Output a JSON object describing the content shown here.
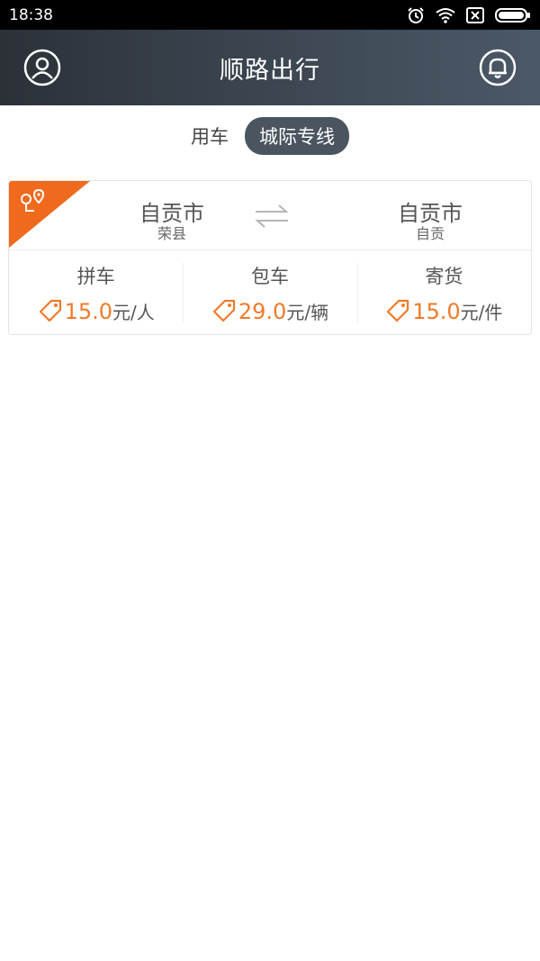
{
  "status": {
    "time": "18:38"
  },
  "header": {
    "title": "顺路出行"
  },
  "tabs": [
    {
      "label": "用车",
      "active": false
    },
    {
      "label": "城际专线",
      "active": true
    }
  ],
  "route": {
    "from": {
      "city": "自贡市",
      "district": "荣县"
    },
    "to": {
      "city": "自贡市",
      "district": "自贡"
    }
  },
  "services": [
    {
      "label": "拼车",
      "price": "15.0",
      "unit": "元/人"
    },
    {
      "label": "包车",
      "price": "29.0",
      "unit": "元/辆"
    },
    {
      "label": "寄货",
      "price": "15.0",
      "unit": "元/件"
    }
  ],
  "colors": {
    "accent": "#f07a2a",
    "header_dark": "#2c3138",
    "header_light": "#4b5866",
    "tab_active_bg": "#4a5560"
  },
  "icons": {
    "profile": "user-circle-icon",
    "notifications": "bell-icon",
    "route_corner": "route-pin-icon",
    "swap": "swap-arrows-icon",
    "price": "price-tag-icon"
  }
}
